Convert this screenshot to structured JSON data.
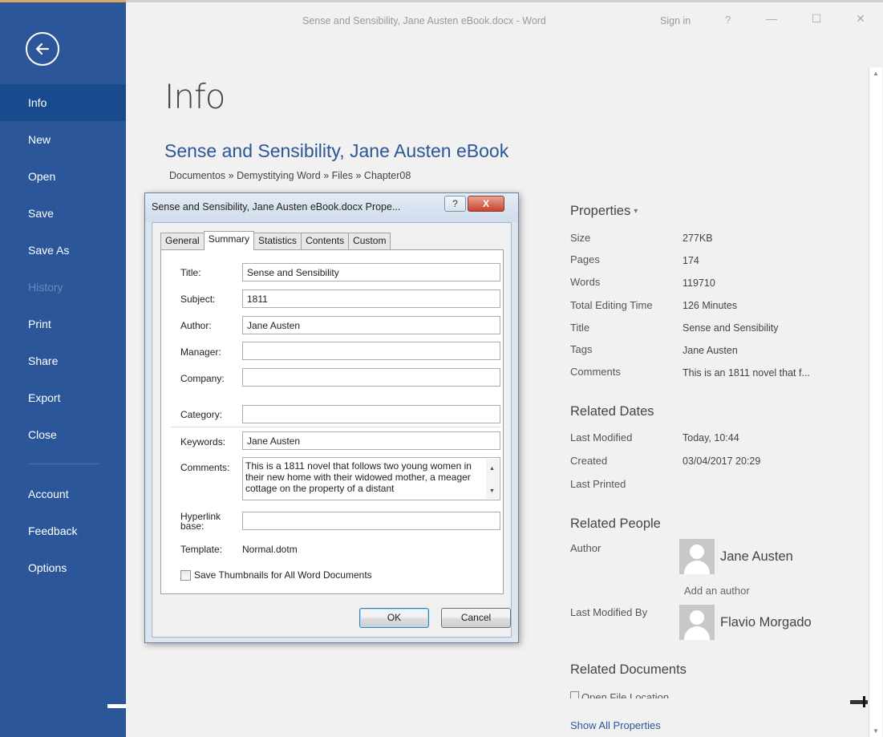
{
  "window": {
    "title": "Sense and Sensibility, Jane Austen eBook.docx - Word",
    "sign_in": "Sign in",
    "help": "?",
    "minimize": "—",
    "maximize": "☐",
    "close": "✕"
  },
  "sidebar": {
    "items": [
      {
        "label": "Info",
        "active": true
      },
      {
        "label": "New"
      },
      {
        "label": "Open"
      },
      {
        "label": "Save"
      },
      {
        "label": "Save As"
      },
      {
        "label": "History",
        "disabled": true
      },
      {
        "label": "Print"
      },
      {
        "label": "Share"
      },
      {
        "label": "Export"
      },
      {
        "label": "Close"
      }
    ],
    "bottom_items": [
      {
        "label": "Account"
      },
      {
        "label": "Feedback"
      },
      {
        "label": "Options"
      }
    ]
  },
  "main": {
    "heading": "Info",
    "doc_title": "Sense and Sensibility, Jane Austen eBook",
    "path": "Documentos » Demystitying Word » Files » Chapter08"
  },
  "properties": {
    "title": "Properties",
    "caret": "▾",
    "rows": [
      {
        "label": "Size",
        "value": "277KB"
      },
      {
        "label": "Pages",
        "value": "174"
      },
      {
        "label": "Words",
        "value": "119710"
      },
      {
        "label": "Total Editing Time",
        "value": "126 Minutes"
      },
      {
        "label": "Title",
        "value": "Sense and Sensibility"
      },
      {
        "label": "Tags",
        "value": "Jane Austen"
      },
      {
        "label": "Comments",
        "value": "This is an 1811 novel that f..."
      }
    ],
    "related_dates": {
      "heading": "Related Dates",
      "rows": [
        {
          "label": "Last Modified",
          "value": "Today, 10:44"
        },
        {
          "label": "Created",
          "value": "03/04/2017 20:29"
        },
        {
          "label": "Last Printed",
          "value": ""
        }
      ]
    },
    "related_people": {
      "heading": "Related People",
      "author_label": "Author",
      "author_name": "Jane Austen",
      "add_author": "Add an author",
      "modified_label": "Last Modified By",
      "modified_name": "Flavio Morgado"
    },
    "related_documents": {
      "heading": "Related Documents",
      "open_location": "Open File Location",
      "show_all": "Show All Properties"
    }
  },
  "dialog": {
    "title": "Sense and Sensibility, Jane Austen eBook.docx Prope...",
    "help_btn": "?",
    "close_btn": "X",
    "tabs": [
      {
        "label": "General"
      },
      {
        "label": "Summary",
        "active": true
      },
      {
        "label": "Statistics"
      },
      {
        "label": "Contents"
      },
      {
        "label": "Custom"
      }
    ],
    "fields": {
      "title_label": "Title:",
      "title_value": "Sense and Sensibility",
      "subject_label": "Subject:",
      "subject_value": "1811",
      "author_label": "Author:",
      "author_value": "Jane Austen",
      "manager_label": "Manager:",
      "manager_value": "",
      "company_label": "Company:",
      "company_value": "",
      "category_label": "Category:",
      "category_value": "",
      "keywords_label": "Keywords:",
      "keywords_value": "Jane Austen",
      "comments_label": "Comments:",
      "comments_value": "This is a 1811 novel that follows two young women in their new home with their widowed mother, a meager cottage on the property of a distant",
      "hyperlink_label_1": "Hyperlink",
      "hyperlink_label_2": "base:",
      "hyperlink_value": "",
      "template_label": "Template:",
      "template_value": "Normal.dotm"
    },
    "checkbox_label": "Save Thumbnails for All Word Documents",
    "ok": "OK",
    "cancel": "Cancel"
  }
}
